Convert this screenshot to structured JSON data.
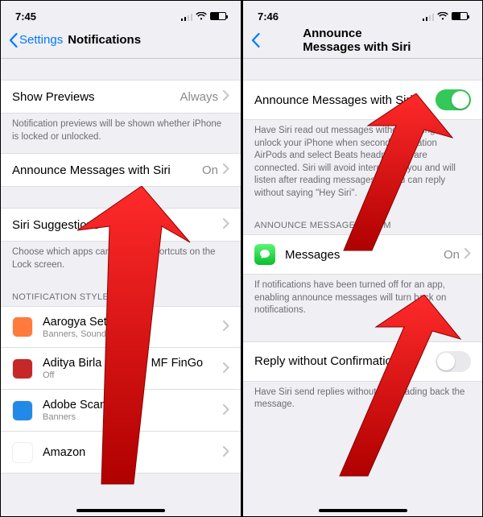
{
  "left": {
    "status": {
      "time": "7:45"
    },
    "nav": {
      "back": "Settings",
      "title": "Notifications"
    },
    "rows": {
      "show_previews": {
        "label": "Show Previews",
        "value": "Always"
      },
      "announce": {
        "label": "Announce Messages with Siri",
        "value": "On"
      },
      "siri_suggest": {
        "label": "Siri Suggestions"
      }
    },
    "footers": {
      "previews": "Notification previews will be shown whether iPhone is locked or unlocked.",
      "siri": "Choose which apps can suggest Shortcuts on the Lock screen."
    },
    "headers": {
      "style": "Notification Style"
    },
    "apps": [
      {
        "name": "Aarogya Setu",
        "sub": "Banners, Sounds, Badges",
        "iconColor": "#ff7b3d"
      },
      {
        "name": "Aditya Birla Sun Life MF FinGo",
        "sub": "Off",
        "iconColor": "#c62828"
      },
      {
        "name": "Adobe Scan",
        "sub": "Banners",
        "iconColor": "#2389e8"
      },
      {
        "name": "Amazon",
        "sub": "",
        "iconColor": "#ffffff"
      }
    ]
  },
  "right": {
    "status": {
      "time": "7:46"
    },
    "nav": {
      "title": "Announce Messages with Siri"
    },
    "rows": {
      "announce_toggle": {
        "label": "Announce Messages with Siri",
        "on": true
      },
      "messages": {
        "label": "Messages",
        "value": "On"
      },
      "reply": {
        "label": "Reply without Confirmation",
        "on": false
      }
    },
    "footers": {
      "announce": "Have Siri read out messages without having to unlock your iPhone when second-generation AirPods and select Beats headphones are connected. Siri will avoid interrupting you and will listen after reading messages so you can reply without saying \"Hey Siri\".",
      "messages": "If notifications have been turned off for an app, enabling announce messages will turn back on notifications.",
      "reply": "Have Siri send replies without first reading back the message."
    },
    "headers": {
      "from": "Announce Messages From"
    }
  }
}
